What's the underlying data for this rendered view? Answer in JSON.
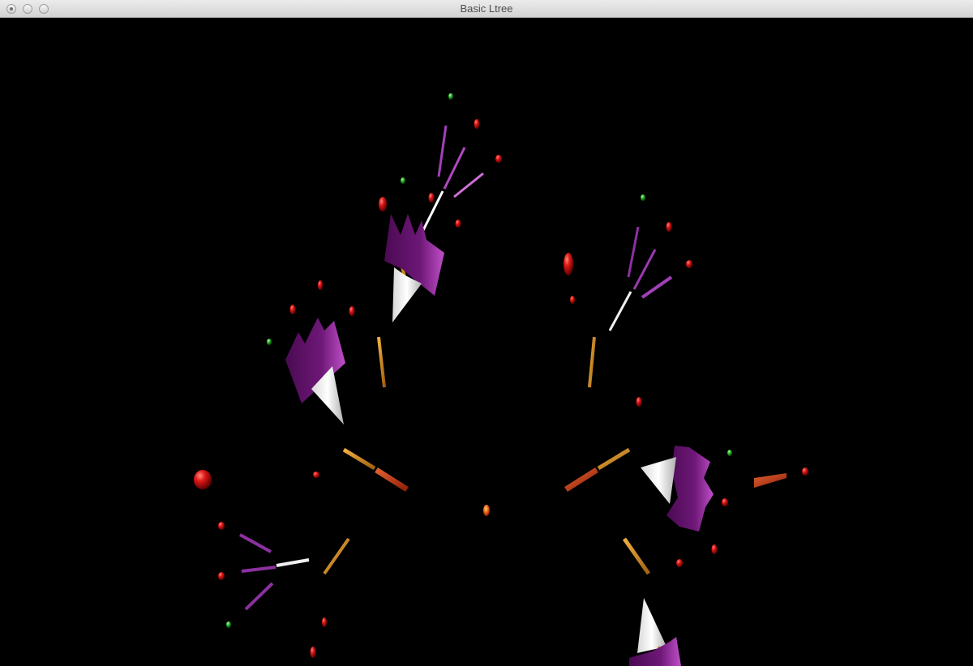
{
  "window": {
    "title": "Basic Ltree",
    "buttons": [
      "close",
      "minimize",
      "zoom"
    ]
  },
  "scene": {
    "background": "#000000",
    "colors": {
      "berry": "#e01010",
      "bud": "#22c022",
      "petal": "#6a1570",
      "petal_light": "#b040b0",
      "cone": "#ffffff",
      "stem": "#d08a20",
      "stem_dark": "#b8401a",
      "twig": "#a040b8"
    }
  }
}
